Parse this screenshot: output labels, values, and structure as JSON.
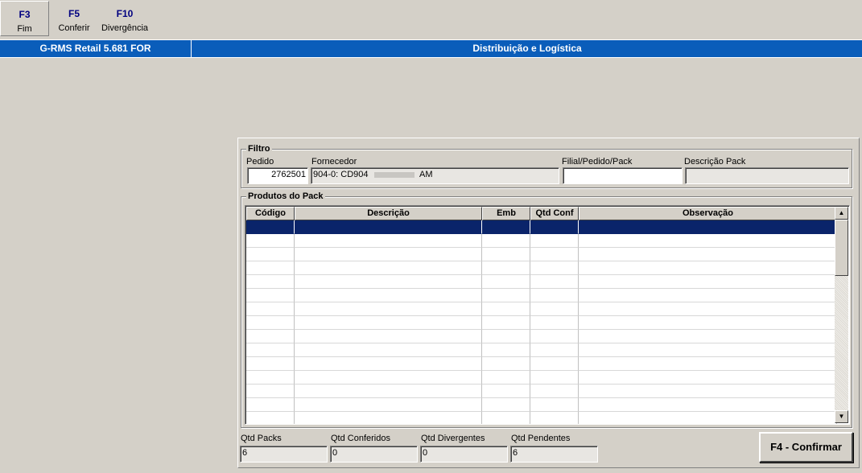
{
  "toolbar": {
    "buttons": [
      {
        "key": "F3",
        "label": "Fim"
      },
      {
        "key": "F5",
        "label": "Conferir"
      },
      {
        "key": "F10",
        "label": "Divergência"
      }
    ]
  },
  "titlebar": {
    "app_version": "G-RMS Retail 5.681 FOR",
    "module": "Distribuição e Logística"
  },
  "filtro": {
    "title": "Filtro",
    "pedido_label": "Pedido",
    "pedido_value": "2762501",
    "fornecedor_label": "Fornecedor",
    "fornecedor_value_prefix": "904-0: CD904",
    "fornecedor_value_suffix": "AM",
    "filial_label": "Filial/Pedido/Pack",
    "filial_value": "",
    "descricao_pack_label": "Descrição Pack",
    "descricao_pack_value": ""
  },
  "produtos": {
    "title": "Produtos do Pack",
    "columns": [
      "Código",
      "Descrição",
      "Emb",
      "Qtd Conf",
      "Observação"
    ],
    "rows": []
  },
  "totais": {
    "qtd_packs_label": "Qtd Packs",
    "qtd_packs_value": "6",
    "qtd_conferidos_label": "Qtd Conferidos",
    "qtd_conferidos_value": "0",
    "qtd_divergentes_label": "Qtd Divergentes",
    "qtd_divergentes_value": "0",
    "qtd_pendentes_label": "Qtd Pendentes",
    "qtd_pendentes_value": "6"
  },
  "confirm_button": "F4 - Confirmar",
  "colors": {
    "titlebar_bg": "#0a5dba",
    "selection": "#0a246a",
    "key_text": "#000080",
    "window_bg": "#d4d0c8"
  }
}
